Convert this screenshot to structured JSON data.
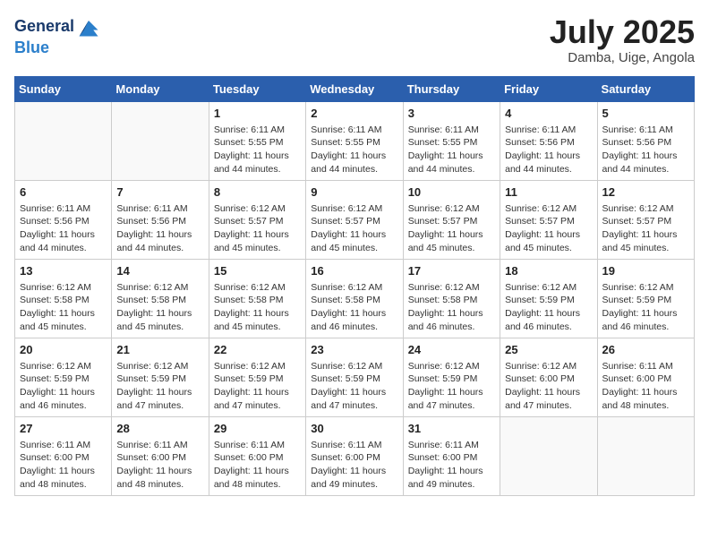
{
  "header": {
    "logo_line1": "General",
    "logo_line2": "Blue",
    "month": "July 2025",
    "location": "Damba, Uige, Angola"
  },
  "weekdays": [
    "Sunday",
    "Monday",
    "Tuesday",
    "Wednesday",
    "Thursday",
    "Friday",
    "Saturday"
  ],
  "weeks": [
    [
      {
        "day": "",
        "info": ""
      },
      {
        "day": "",
        "info": ""
      },
      {
        "day": "1",
        "info": "Sunrise: 6:11 AM\nSunset: 5:55 PM\nDaylight: 11 hours and 44 minutes."
      },
      {
        "day": "2",
        "info": "Sunrise: 6:11 AM\nSunset: 5:55 PM\nDaylight: 11 hours and 44 minutes."
      },
      {
        "day": "3",
        "info": "Sunrise: 6:11 AM\nSunset: 5:55 PM\nDaylight: 11 hours and 44 minutes."
      },
      {
        "day": "4",
        "info": "Sunrise: 6:11 AM\nSunset: 5:56 PM\nDaylight: 11 hours and 44 minutes."
      },
      {
        "day": "5",
        "info": "Sunrise: 6:11 AM\nSunset: 5:56 PM\nDaylight: 11 hours and 44 minutes."
      }
    ],
    [
      {
        "day": "6",
        "info": "Sunrise: 6:11 AM\nSunset: 5:56 PM\nDaylight: 11 hours and 44 minutes."
      },
      {
        "day": "7",
        "info": "Sunrise: 6:11 AM\nSunset: 5:56 PM\nDaylight: 11 hours and 44 minutes."
      },
      {
        "day": "8",
        "info": "Sunrise: 6:12 AM\nSunset: 5:57 PM\nDaylight: 11 hours and 45 minutes."
      },
      {
        "day": "9",
        "info": "Sunrise: 6:12 AM\nSunset: 5:57 PM\nDaylight: 11 hours and 45 minutes."
      },
      {
        "day": "10",
        "info": "Sunrise: 6:12 AM\nSunset: 5:57 PM\nDaylight: 11 hours and 45 minutes."
      },
      {
        "day": "11",
        "info": "Sunrise: 6:12 AM\nSunset: 5:57 PM\nDaylight: 11 hours and 45 minutes."
      },
      {
        "day": "12",
        "info": "Sunrise: 6:12 AM\nSunset: 5:57 PM\nDaylight: 11 hours and 45 minutes."
      }
    ],
    [
      {
        "day": "13",
        "info": "Sunrise: 6:12 AM\nSunset: 5:58 PM\nDaylight: 11 hours and 45 minutes."
      },
      {
        "day": "14",
        "info": "Sunrise: 6:12 AM\nSunset: 5:58 PM\nDaylight: 11 hours and 45 minutes."
      },
      {
        "day": "15",
        "info": "Sunrise: 6:12 AM\nSunset: 5:58 PM\nDaylight: 11 hours and 45 minutes."
      },
      {
        "day": "16",
        "info": "Sunrise: 6:12 AM\nSunset: 5:58 PM\nDaylight: 11 hours and 46 minutes."
      },
      {
        "day": "17",
        "info": "Sunrise: 6:12 AM\nSunset: 5:58 PM\nDaylight: 11 hours and 46 minutes."
      },
      {
        "day": "18",
        "info": "Sunrise: 6:12 AM\nSunset: 5:59 PM\nDaylight: 11 hours and 46 minutes."
      },
      {
        "day": "19",
        "info": "Sunrise: 6:12 AM\nSunset: 5:59 PM\nDaylight: 11 hours and 46 minutes."
      }
    ],
    [
      {
        "day": "20",
        "info": "Sunrise: 6:12 AM\nSunset: 5:59 PM\nDaylight: 11 hours and 46 minutes."
      },
      {
        "day": "21",
        "info": "Sunrise: 6:12 AM\nSunset: 5:59 PM\nDaylight: 11 hours and 47 minutes."
      },
      {
        "day": "22",
        "info": "Sunrise: 6:12 AM\nSunset: 5:59 PM\nDaylight: 11 hours and 47 minutes."
      },
      {
        "day": "23",
        "info": "Sunrise: 6:12 AM\nSunset: 5:59 PM\nDaylight: 11 hours and 47 minutes."
      },
      {
        "day": "24",
        "info": "Sunrise: 6:12 AM\nSunset: 5:59 PM\nDaylight: 11 hours and 47 minutes."
      },
      {
        "day": "25",
        "info": "Sunrise: 6:12 AM\nSunset: 6:00 PM\nDaylight: 11 hours and 47 minutes."
      },
      {
        "day": "26",
        "info": "Sunrise: 6:11 AM\nSunset: 6:00 PM\nDaylight: 11 hours and 48 minutes."
      }
    ],
    [
      {
        "day": "27",
        "info": "Sunrise: 6:11 AM\nSunset: 6:00 PM\nDaylight: 11 hours and 48 minutes."
      },
      {
        "day": "28",
        "info": "Sunrise: 6:11 AM\nSunset: 6:00 PM\nDaylight: 11 hours and 48 minutes."
      },
      {
        "day": "29",
        "info": "Sunrise: 6:11 AM\nSunset: 6:00 PM\nDaylight: 11 hours and 48 minutes."
      },
      {
        "day": "30",
        "info": "Sunrise: 6:11 AM\nSunset: 6:00 PM\nDaylight: 11 hours and 49 minutes."
      },
      {
        "day": "31",
        "info": "Sunrise: 6:11 AM\nSunset: 6:00 PM\nDaylight: 11 hours and 49 minutes."
      },
      {
        "day": "",
        "info": ""
      },
      {
        "day": "",
        "info": ""
      }
    ]
  ]
}
